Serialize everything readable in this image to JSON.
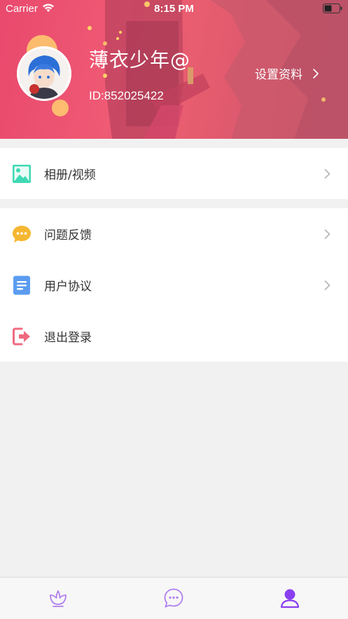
{
  "status_bar": {
    "carrier": "Carrier",
    "time": "8:15 PM"
  },
  "profile": {
    "username": "薄衣少年@",
    "user_id": "ID:852025422",
    "settings_label": "设置资料",
    "header_color": "#e9496d"
  },
  "menu_primary": [
    {
      "label": "相册/视频",
      "icon": "photo-album-icon",
      "color": "#3ed9b4"
    }
  ],
  "menu_secondary": [
    {
      "label": "问题反馈",
      "icon": "feedback-chat-icon",
      "color": "#f5b731"
    },
    {
      "label": "用户协议",
      "icon": "document-icon",
      "color": "#5b9cf0"
    },
    {
      "label": "退出登录",
      "icon": "logout-icon",
      "color": "#f06a7f"
    }
  ],
  "tabbar": {
    "tabs": [
      {
        "icon": "flower-icon",
        "active": false
      },
      {
        "icon": "chat-bubble-icon",
        "active": false
      },
      {
        "icon": "profile-icon",
        "active": true
      }
    ],
    "accent": "#8a3ff0"
  }
}
